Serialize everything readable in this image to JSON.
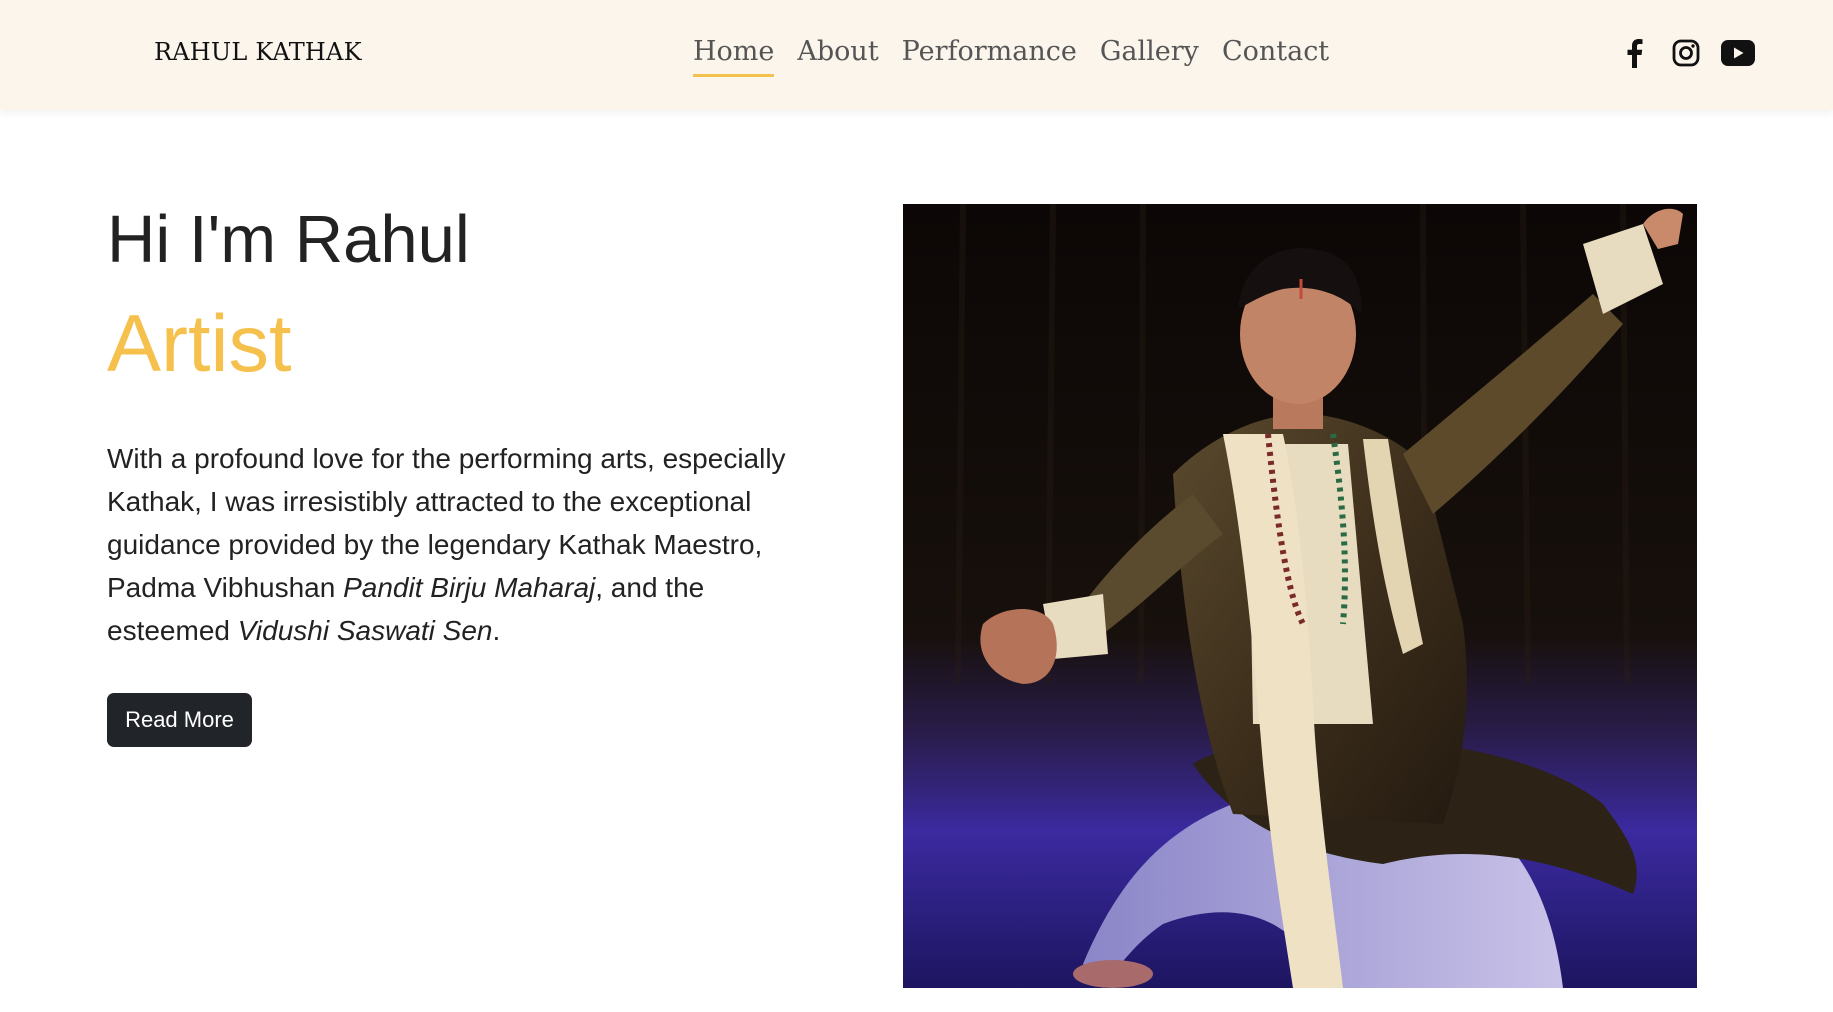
{
  "brand": "RAHUL KATHAK",
  "nav": {
    "items": [
      {
        "label": "Home",
        "active": true
      },
      {
        "label": "About"
      },
      {
        "label": "Performance"
      },
      {
        "label": "Gallery"
      },
      {
        "label": "Contact"
      }
    ]
  },
  "socials": [
    "facebook-icon",
    "instagram-icon",
    "youtube-icon"
  ],
  "hero": {
    "greeting": "Hi I'm Rahul",
    "role": "Artist",
    "bio": {
      "p1": "With a profound love for the performing arts, especially Kathak, I was irresistibly attracted to the exceptional guidance provided by the legendary Kathak Maestro, Padma Vibhushan ",
      "name1": "Pandit Birju Maharaj",
      "p2": ", and the esteemed ",
      "name2": "Vidushi Saswati Sen",
      "p3": "."
    },
    "button": "Read More"
  },
  "colors": {
    "accent": "#f5c14c",
    "nav_bg": "#fbf5ec",
    "button_bg": "#212529"
  }
}
